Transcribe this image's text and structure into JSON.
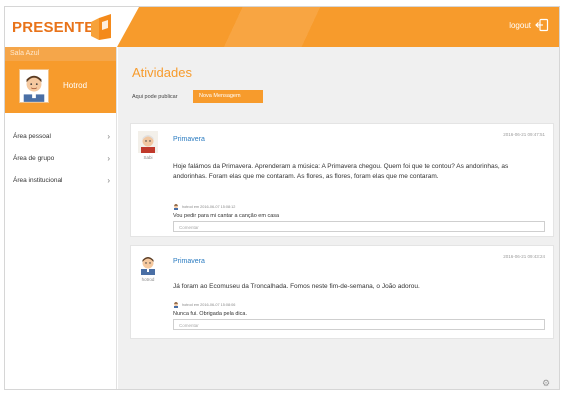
{
  "app": {
    "logo": "PRESENTE",
    "logout_label": "logout"
  },
  "sidebar": {
    "room_label": "Sala Azul",
    "profile_name": "Hotrod",
    "items": [
      {
        "label": "Área pessoal"
      },
      {
        "label": "Área de grupo"
      },
      {
        "label": "Área institucional"
      }
    ]
  },
  "main": {
    "title": "Atividades",
    "filter_label": "Aqui pode publicar",
    "filter_button": "Nova Mensagem"
  },
  "posts": [
    {
      "author": "Sabi",
      "topic": "Primavera",
      "date": "2016-06-21 09:47:51",
      "body": "Hoje falámos da Primavera. Aprenderam a música: A Primavera chegou. Quem foi que te contou? As andorinhas, as andorinhas. Foram elas que me contaram. As flores, as flores, foram elas que me contaram.",
      "comment_meta": "hotrod em 2016-06-07 15:08:12",
      "comment": "Vou pedir para mi cantar a canção em casa",
      "comment_placeholder": "Comentar"
    },
    {
      "author": "hotrod",
      "topic": "Primavera",
      "date": "2016-06-21 09:43:24",
      "body": "Já foram ao Ecomuseu da Troncalhada. Fomos neste fim-de-semana, o João adorou.",
      "comment_meta": "hotrod em 2016-06-07 15:08:06",
      "comment": "Nunca fui. Obrigada pela dica.",
      "comment_placeholder": "Comentar"
    }
  ],
  "colors": {
    "brand_orange": "#f79b2c",
    "link_blue": "#2a7bc0",
    "main_bg": "#f0f0f0"
  },
  "icons": {
    "logout": "logout-icon",
    "settings": "gear-icon",
    "chevron": "chevron-right-icon"
  }
}
